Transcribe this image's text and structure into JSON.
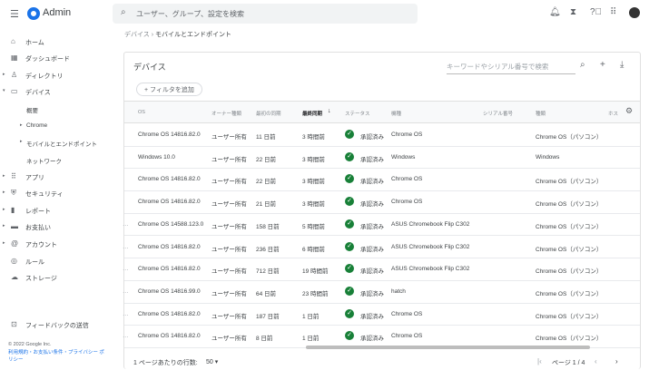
{
  "app": {
    "name": "Admin",
    "search_placeholder": "ユーザー、グループ、設定を検索"
  },
  "breadcrumb": {
    "parent": "デバイス",
    "separator": "›",
    "current": "モバイルとエンドポイント"
  },
  "sidebar": {
    "items": [
      {
        "label": "ホーム",
        "icon": "home-icon",
        "glyph": "⌂",
        "arrow": ""
      },
      {
        "label": "ダッシュボード",
        "icon": "dashboard-icon",
        "glyph": "▦",
        "arrow": ""
      },
      {
        "label": "ディレクトリ",
        "icon": "person-icon",
        "glyph": "♙",
        "arrow": "▸"
      },
      {
        "label": "デバイス",
        "icon": "devices-icon",
        "glyph": "▭",
        "arrow": "▾"
      },
      {
        "label": "概要",
        "icon": "",
        "glyph": "",
        "arrow": ""
      },
      {
        "label": "Chrome",
        "icon": "",
        "glyph": "",
        "arrow": "▸"
      },
      {
        "label": "モバイルとエンドポイント",
        "icon": "",
        "glyph": "",
        "arrow": "▸"
      },
      {
        "label": "ネットワーク",
        "icon": "",
        "glyph": "",
        "arrow": ""
      },
      {
        "label": "アプリ",
        "icon": "apps-icon",
        "glyph": "⠿",
        "arrow": "▸"
      },
      {
        "label": "セキュリティ",
        "icon": "shield-icon",
        "glyph": "⛨",
        "arrow": "▸"
      },
      {
        "label": "レポート",
        "icon": "bar-chart-icon",
        "glyph": "▮",
        "arrow": "▸"
      },
      {
        "label": "お支払い",
        "icon": "credit-card-icon",
        "glyph": "▬",
        "arrow": "▸"
      },
      {
        "label": "アカウント",
        "icon": "at-icon",
        "glyph": "@",
        "arrow": "▸"
      },
      {
        "label": "ルール",
        "icon": "rules-icon",
        "glyph": "◎",
        "arrow": ""
      },
      {
        "label": "ストレージ",
        "icon": "cloud-icon",
        "glyph": "☁",
        "arrow": ""
      }
    ],
    "feedback": "フィードバックの送信",
    "copyright": "© 2022 Google Inc.",
    "links": "利用規約・お支払い条件・プライバシー ポリシー"
  },
  "card": {
    "title": "デバイス",
    "search_placeholder": "キーワードやシリアル番号で検索",
    "add_filter": "フィルタを追加"
  },
  "table": {
    "columns": [
      "OS",
      "オーナー種類",
      "最初の同期",
      "最終同期",
      "ステータス",
      "機種",
      "シリアル番号",
      "種類",
      "ホス"
    ],
    "sort_column": "最終同期",
    "sort_direction": "descending",
    "rows": [
      [
        "Chrome OS 14816.82.0",
        "ユーザー所有",
        "11 日前",
        "3 時間前",
        "承認済み",
        "Chrome OS",
        "",
        "Chrome OS（パソコン）"
      ],
      [
        "Windows 10.0",
        "ユーザー所有",
        "22 日前",
        "3 時間前",
        "承認済み",
        "Windows",
        "",
        "Windows"
      ],
      [
        "Chrome OS 14816.82.0",
        "ユーザー所有",
        "22 日前",
        "3 時間前",
        "承認済み",
        "Chrome OS",
        "",
        "Chrome OS（パソコン）"
      ],
      [
        "Chrome OS 14816.82.0",
        "ユーザー所有",
        "21 日前",
        "3 時間前",
        "承認済み",
        "Chrome OS",
        "",
        "Chrome OS（パソコン）"
      ],
      [
        "Chrome OS 14588.123.0",
        "ユーザー所有",
        "158 日前",
        "5 時間前",
        "承認済み",
        "ASUS Chromebook Flip C302",
        "",
        "Chrome OS（パソコン）"
      ],
      [
        "Chrome OS 14816.82.0",
        "ユーザー所有",
        "236 日前",
        "6 時間前",
        "承認済み",
        "ASUS Chromebook Flip C302",
        "",
        "Chrome OS（パソコン）"
      ],
      [
        "Chrome OS 14816.82.0",
        "ユーザー所有",
        "712 日前",
        "19 時間前",
        "承認済み",
        "ASUS Chromebook Flip C302",
        "",
        "Chrome OS（パソコン）"
      ],
      [
        "Chrome OS 14816.99.0",
        "ユーザー所有",
        "64 日前",
        "23 時間前",
        "承認済み",
        "hatch",
        "",
        "Chrome OS（パソコン）"
      ],
      [
        "Chrome OS 14816.82.0",
        "ユーザー所有",
        "187 日前",
        "1 日前",
        "承認済み",
        "Chrome OS",
        "",
        "Chrome OS（パソコン）"
      ],
      [
        "Chrome OS 14816.82.0",
        "ユーザー所有",
        "8 日前",
        "1 日前",
        "承認済み",
        "Chrome OS",
        "",
        "Chrome OS（パソコン）"
      ]
    ]
  },
  "pagination": {
    "rows_per_page_label": "1 ページあたりの行数:",
    "rows_per_page": "50",
    "page_label": "ページ 1 / 4"
  },
  "colors": {
    "accent": "#1a73e8",
    "approved": "#188038"
  }
}
